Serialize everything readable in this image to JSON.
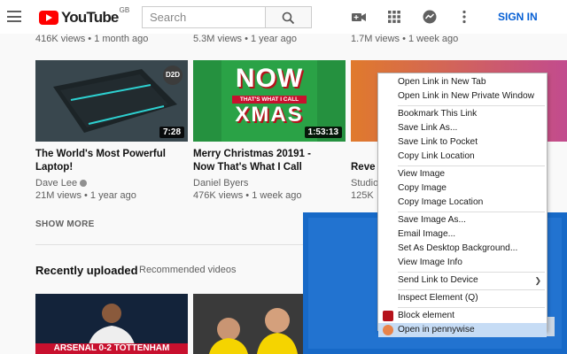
{
  "header": {
    "logo_text": "YouTube",
    "region": "GB",
    "search_placeholder": "Search",
    "signin_label": "SIGN IN"
  },
  "top_stats": [
    "416K views • 1 month ago",
    "5.3M views • 1 year ago",
    "1.7M views • 1 week ago"
  ],
  "videos": [
    {
      "title_line1": "The World's Most Powerful",
      "title_line2": "Laptop!",
      "channel": "Dave Lee",
      "meta": "21M views • 1 year ago",
      "duration": "7:28",
      "badge": "D2D"
    },
    {
      "title_line1": "Merry Christmas 20191 -",
      "title_line2": "Now That's What I Call",
      "channel": "Daniel Byers",
      "meta": "476K views • 1 week ago",
      "duration": "1:53:13",
      "thumb_text_1": "NOW",
      "thumb_text_2": "THAT'S WHAT I CALL",
      "thumb_text_3": "XMAS"
    },
    {
      "title_line2": "Reve",
      "channel": "Studio",
      "meta": "125K"
    }
  ],
  "show_more": "SHOW MORE",
  "recent": {
    "title": "Recently uploaded",
    "subtitle": "Recommended videos",
    "thumb1_caption": "ARSENAL 0-2 TOTTENHAM"
  },
  "context_menu": {
    "items": [
      "Open Link in New Tab",
      "Open Link in New Private Window",
      "Bookmark This Link",
      "Save Link As...",
      "Save Link to Pocket",
      "Copy Link Location",
      "View Image",
      "Copy Image",
      "Copy Image Location",
      "Save Image As...",
      "Email Image...",
      "Set As Desktop Background...",
      "View Image Info",
      "Send Link to Device",
      "Inspect Element (Q)",
      "Block element",
      "Open in pennywise"
    ]
  },
  "colors": {
    "brand_red": "#ff0000",
    "signin_blue": "#065fd4",
    "menu_highlight": "#c6dcf5"
  }
}
